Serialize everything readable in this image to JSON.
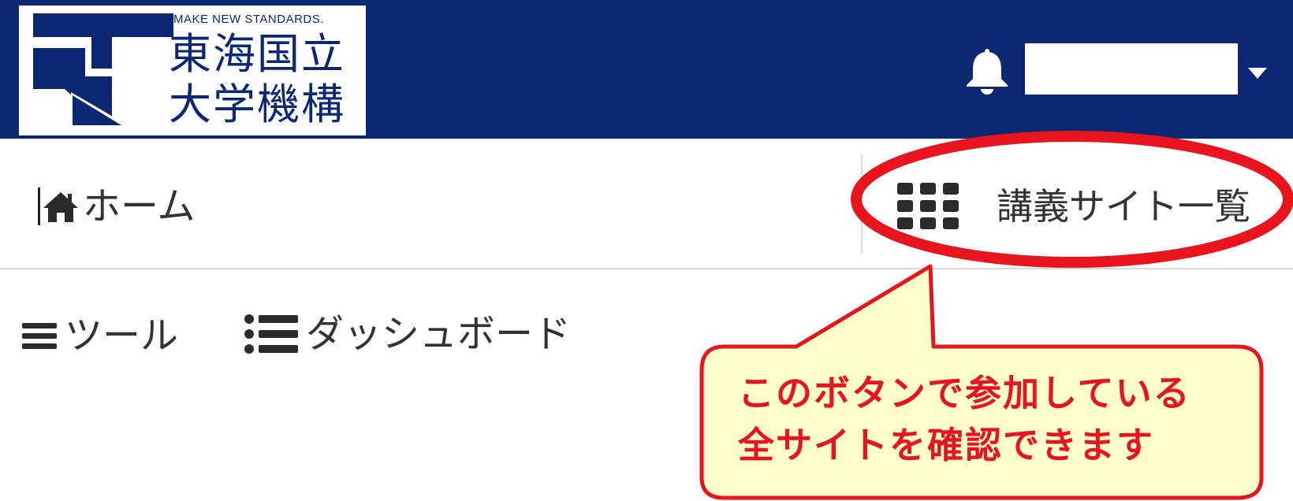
{
  "header": {
    "logo": {
      "tagline": "MAKE NEW STANDARDS.",
      "line1": "東海国立",
      "line2": "大学機構"
    },
    "user": {
      "name": ""
    },
    "icons": {
      "bell": "bell-icon",
      "caret": "caret-down-icon"
    }
  },
  "nav": {
    "home": {
      "label": "ホーム",
      "icon": "home-icon"
    },
    "sites": {
      "label": "講義サイト一覧",
      "icon": "grid-icon"
    }
  },
  "tools": {
    "tools_label": "ツール",
    "dashboard_label": "ダッシュボード",
    "icons": {
      "tools": "menu-icon",
      "dashboard": "list-icon"
    }
  },
  "annotation": {
    "line1": "このボタンで参加している",
    "line2": "全サイトを確認できます",
    "colors": {
      "highlight": "#e8141e",
      "callout_fill": "#ffffcc",
      "callout_text": "#e8141e"
    }
  },
  "colors": {
    "header_bg": "#0d2873",
    "text": "#333333",
    "icon": "#2b2b2b"
  }
}
